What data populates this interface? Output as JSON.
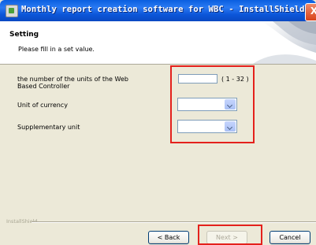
{
  "window": {
    "title": "Monthly report creation software for WBC - InstallShield Wizard",
    "close_label": "X"
  },
  "header": {
    "title": "Setting",
    "subtitle": "Please fill in a set value."
  },
  "form": {
    "units_label": "the number of the units of the Web Based Controller",
    "units_value": "",
    "units_range": "( 1 - 32 )",
    "currency_label": "Unit of currency",
    "currency_value": "",
    "supplementary_label": "Supplementary unit",
    "supplementary_value": ""
  },
  "footer": {
    "brand": "InstallShield",
    "back_label": "< Back",
    "next_label": "Next >",
    "cancel_label": "Cancel"
  },
  "colors": {
    "highlight": "#e4211c",
    "titlebar": "#0b55d8"
  }
}
